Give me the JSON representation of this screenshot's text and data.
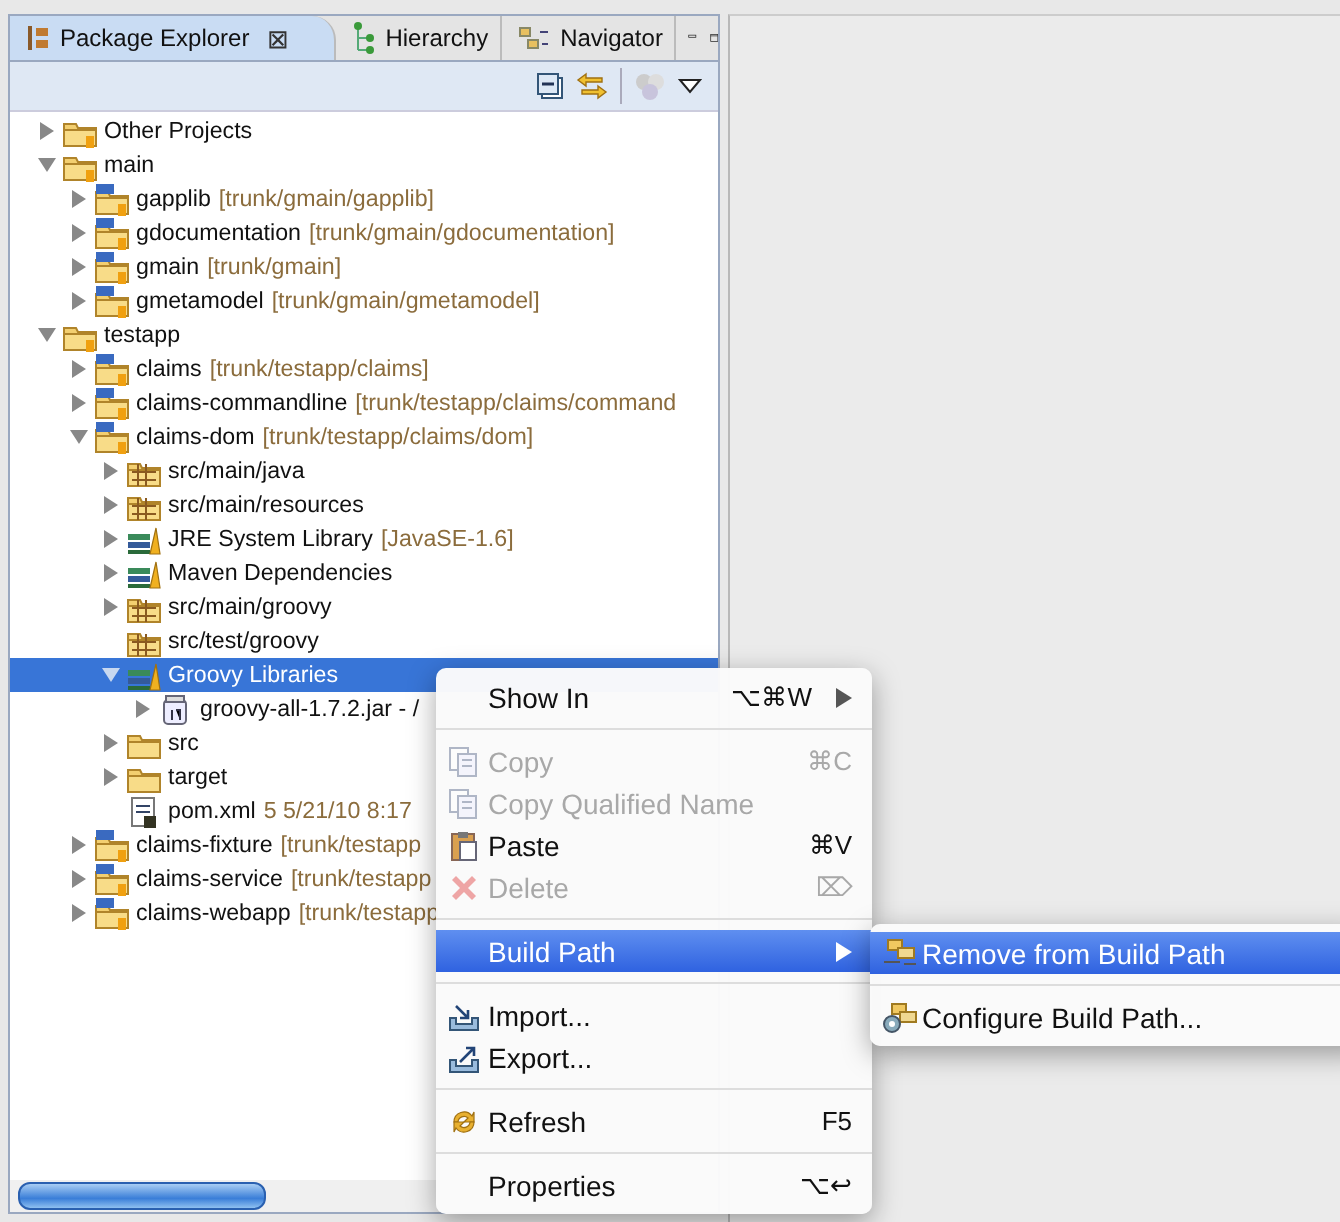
{
  "view_tabs": [
    {
      "label": "Package Explorer",
      "selected": true,
      "close": "⊠"
    },
    {
      "label": "Hierarchy",
      "selected": false
    },
    {
      "label": "Navigator",
      "selected": false
    }
  ],
  "tree": [
    {
      "label": "Other Projects",
      "kind": "working-set",
      "expanded": false,
      "selected": false
    },
    {
      "label": "main",
      "kind": "working-set",
      "expanded": true,
      "selected": false,
      "children": [
        {
          "label": "gapplib",
          "decoration": "[trunk/gmain/gapplib]",
          "kind": "project",
          "expanded": false,
          "selected": false
        },
        {
          "label": "gdocumentation",
          "decoration": "[trunk/gmain/gdocumentation]",
          "kind": "project",
          "expanded": false,
          "selected": false
        },
        {
          "label": "gmain",
          "decoration": "[trunk/gmain]",
          "kind": "project",
          "expanded": false,
          "selected": false
        },
        {
          "label": "gmetamodel",
          "decoration": "[trunk/gmain/gmetamodel]",
          "kind": "project",
          "expanded": false,
          "selected": false
        }
      ]
    },
    {
      "label": "testapp",
      "kind": "working-set",
      "expanded": true,
      "selected": false,
      "children": [
        {
          "label": "claims",
          "decoration": "[trunk/testapp/claims]",
          "kind": "project",
          "expanded": false,
          "selected": false
        },
        {
          "label": "claims-commandline",
          "decoration": "[trunk/testapp/claims/command",
          "kind": "project",
          "expanded": false,
          "selected": false
        },
        {
          "label": "claims-dom",
          "decoration": "[trunk/testapp/claims/dom]",
          "kind": "project",
          "expanded": true,
          "selected": false,
          "children": [
            {
              "label": "src/main/java",
              "kind": "source",
              "expanded": false,
              "selected": false
            },
            {
              "label": "src/main/resources",
              "kind": "source",
              "expanded": false,
              "selected": false
            },
            {
              "label": "JRE System Library",
              "decoration": "[JavaSE-1.6]",
              "kind": "library",
              "expanded": false,
              "selected": false
            },
            {
              "label": "Maven Dependencies",
              "kind": "library",
              "expanded": false,
              "selected": false
            },
            {
              "label": "src/main/groovy",
              "kind": "source",
              "expanded": false,
              "selected": false
            },
            {
              "label": "src/test/groovy",
              "kind": "source",
              "selected": false
            },
            {
              "label": "Groovy Libraries",
              "kind": "library",
              "expanded": true,
              "selected": true,
              "children": [
                {
                  "label": "groovy-all-1.7.2.jar - /",
                  "kind": "jar",
                  "expanded": false,
                  "selected": false
                }
              ]
            },
            {
              "label": "src",
              "kind": "folder",
              "expanded": false,
              "selected": false
            },
            {
              "label": "target",
              "kind": "folder",
              "expanded": false,
              "selected": false
            },
            {
              "label": "pom.xml",
              "decoration": "5  5/21/10 8:17",
              "kind": "file",
              "selected": false
            }
          ]
        },
        {
          "label": "claims-fixture",
          "decoration": "[trunk/testapp",
          "kind": "project",
          "expanded": false,
          "selected": false
        },
        {
          "label": "claims-service",
          "decoration": "[trunk/testapp",
          "kind": "project",
          "expanded": false,
          "selected": false
        },
        {
          "label": "claims-webapp",
          "decoration": "[trunk/testapp",
          "kind": "project",
          "expanded": false,
          "selected": false
        }
      ]
    }
  ],
  "context_menu": [
    {
      "kind": "submenu",
      "label": "Show In",
      "shortcut": "⌥⌘W",
      "disabled": false,
      "selected": false
    },
    {
      "kind": "separator"
    },
    {
      "kind": "item",
      "label": "Copy",
      "shortcut": "⌘C",
      "disabled": true,
      "selected": false
    },
    {
      "kind": "item",
      "label": "Copy Qualified Name",
      "disabled": true,
      "selected": false
    },
    {
      "kind": "item",
      "label": "Paste",
      "shortcut": "⌘V",
      "disabled": false,
      "selected": false
    },
    {
      "kind": "item",
      "label": "Delete",
      "shortcut": "⌦",
      "disabled": true,
      "selected": false
    },
    {
      "kind": "separator"
    },
    {
      "kind": "submenu",
      "label": "Build Path",
      "disabled": false,
      "selected": true
    },
    {
      "kind": "separator"
    },
    {
      "kind": "item",
      "label": "Import...",
      "disabled": false,
      "selected": false
    },
    {
      "kind": "item",
      "label": "Export...",
      "disabled": false,
      "selected": false
    },
    {
      "kind": "separator"
    },
    {
      "kind": "item",
      "label": "Refresh",
      "shortcut": "F5",
      "disabled": false,
      "selected": false
    },
    {
      "kind": "separator"
    },
    {
      "kind": "item",
      "label": "Properties",
      "shortcut": "⌥↩",
      "disabled": false,
      "selected": false
    }
  ],
  "submenu": [
    {
      "kind": "item",
      "label": "Remove from Build Path",
      "selected": true
    },
    {
      "kind": "separator"
    },
    {
      "kind": "item",
      "label": "Configure Build Path...",
      "selected": false
    }
  ]
}
